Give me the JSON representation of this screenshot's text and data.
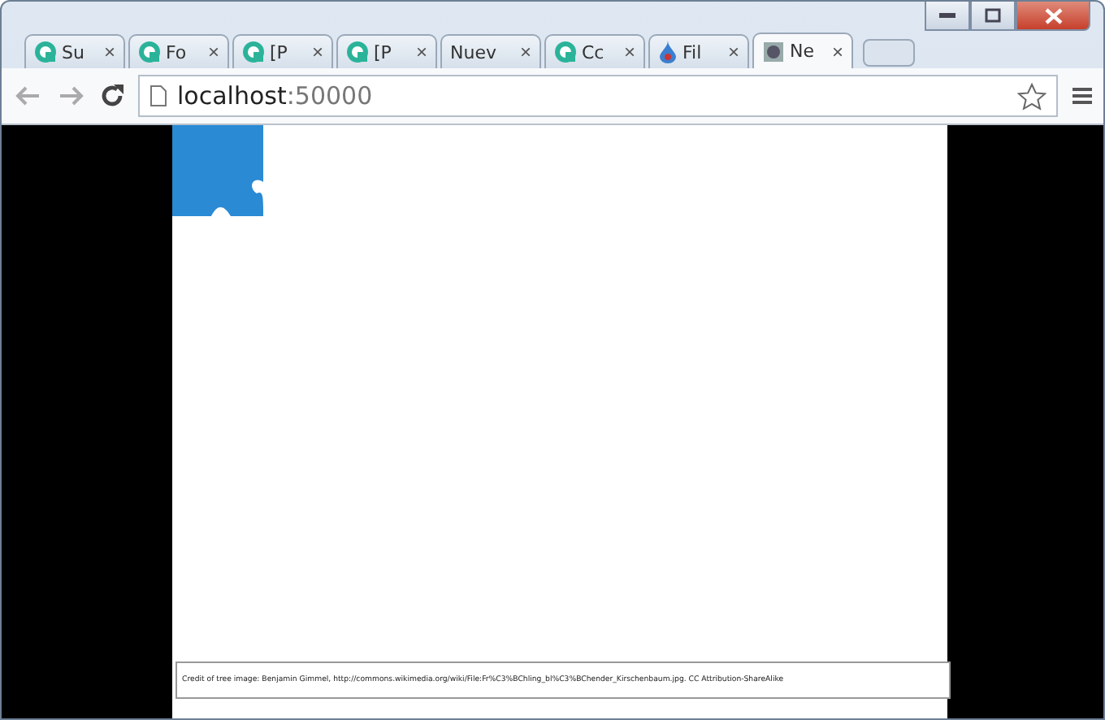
{
  "tabs": [
    {
      "label": "Su",
      "kind": "globe",
      "close": "×",
      "selected": false
    },
    {
      "label": "Fo",
      "kind": "globe",
      "close": "×",
      "selected": false
    },
    {
      "label": "[P",
      "kind": "globe",
      "close": "×",
      "selected": false
    },
    {
      "label": "[P",
      "kind": "globe",
      "close": "×",
      "selected": false
    },
    {
      "label": "Nuev",
      "kind": "plain",
      "close": "×",
      "selected": false
    },
    {
      "label": "Cc",
      "kind": "globe",
      "close": "×",
      "selected": false
    },
    {
      "label": "Fil",
      "kind": "drop",
      "close": "×",
      "selected": false
    },
    {
      "label": "Ne",
      "kind": "page",
      "close": "×",
      "selected": true
    }
  ],
  "address": {
    "host": "localhost",
    "port": ":50000"
  },
  "page": {
    "credit": "Credit of tree image: Benjamin Gimmel, http://commons.wikimedia.org/wiki/File:Fr%C3%BChling_bl%C3%BChender_Kirschenbaum.jpg. CC Attribution-ShareAlike"
  }
}
